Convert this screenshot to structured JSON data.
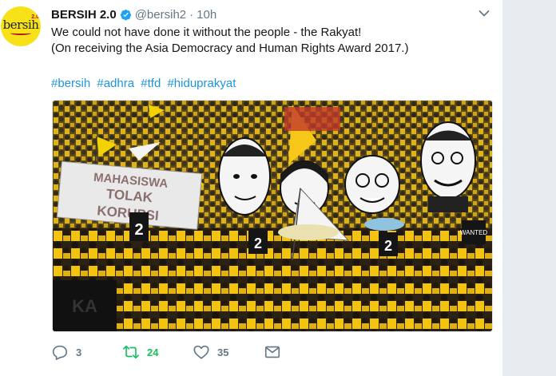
{
  "tweet": {
    "display_name": "BERSIH 2.0",
    "handle": "@bersih2",
    "separator": "·",
    "time": "10h",
    "text_line1": "We could not have done it without the people - the Rakyat!",
    "text_line2": "(On receiving the Asia Democracy and Human Rights Award 2017.)",
    "hashtags": [
      "#bersih",
      "#adhra",
      "#tfd",
      "#hiduprakyat"
    ]
  },
  "avatar": {
    "logo": "bersih",
    "logo_sub": "2.0"
  },
  "photo": {
    "banner_text_line1": "MAHASISWA",
    "banner_text_line2": "TOLAK",
    "banner_text_line3": "KORUPSI",
    "placard_number": "2",
    "placard_label": "WANTED"
  },
  "actions": {
    "reply_count": "3",
    "retweet_count": "24",
    "like_count": "35"
  },
  "colors": {
    "link": "#1b95e0",
    "retweet_green": "#17bf63",
    "muted": "#657786",
    "verified_blue": "#1da1f2",
    "crowd_yellow": "#f2c40f"
  },
  "icons": [
    "verified-badge-icon",
    "caret-down-icon",
    "reply-icon",
    "retweet-icon",
    "like-icon",
    "message-icon"
  ]
}
